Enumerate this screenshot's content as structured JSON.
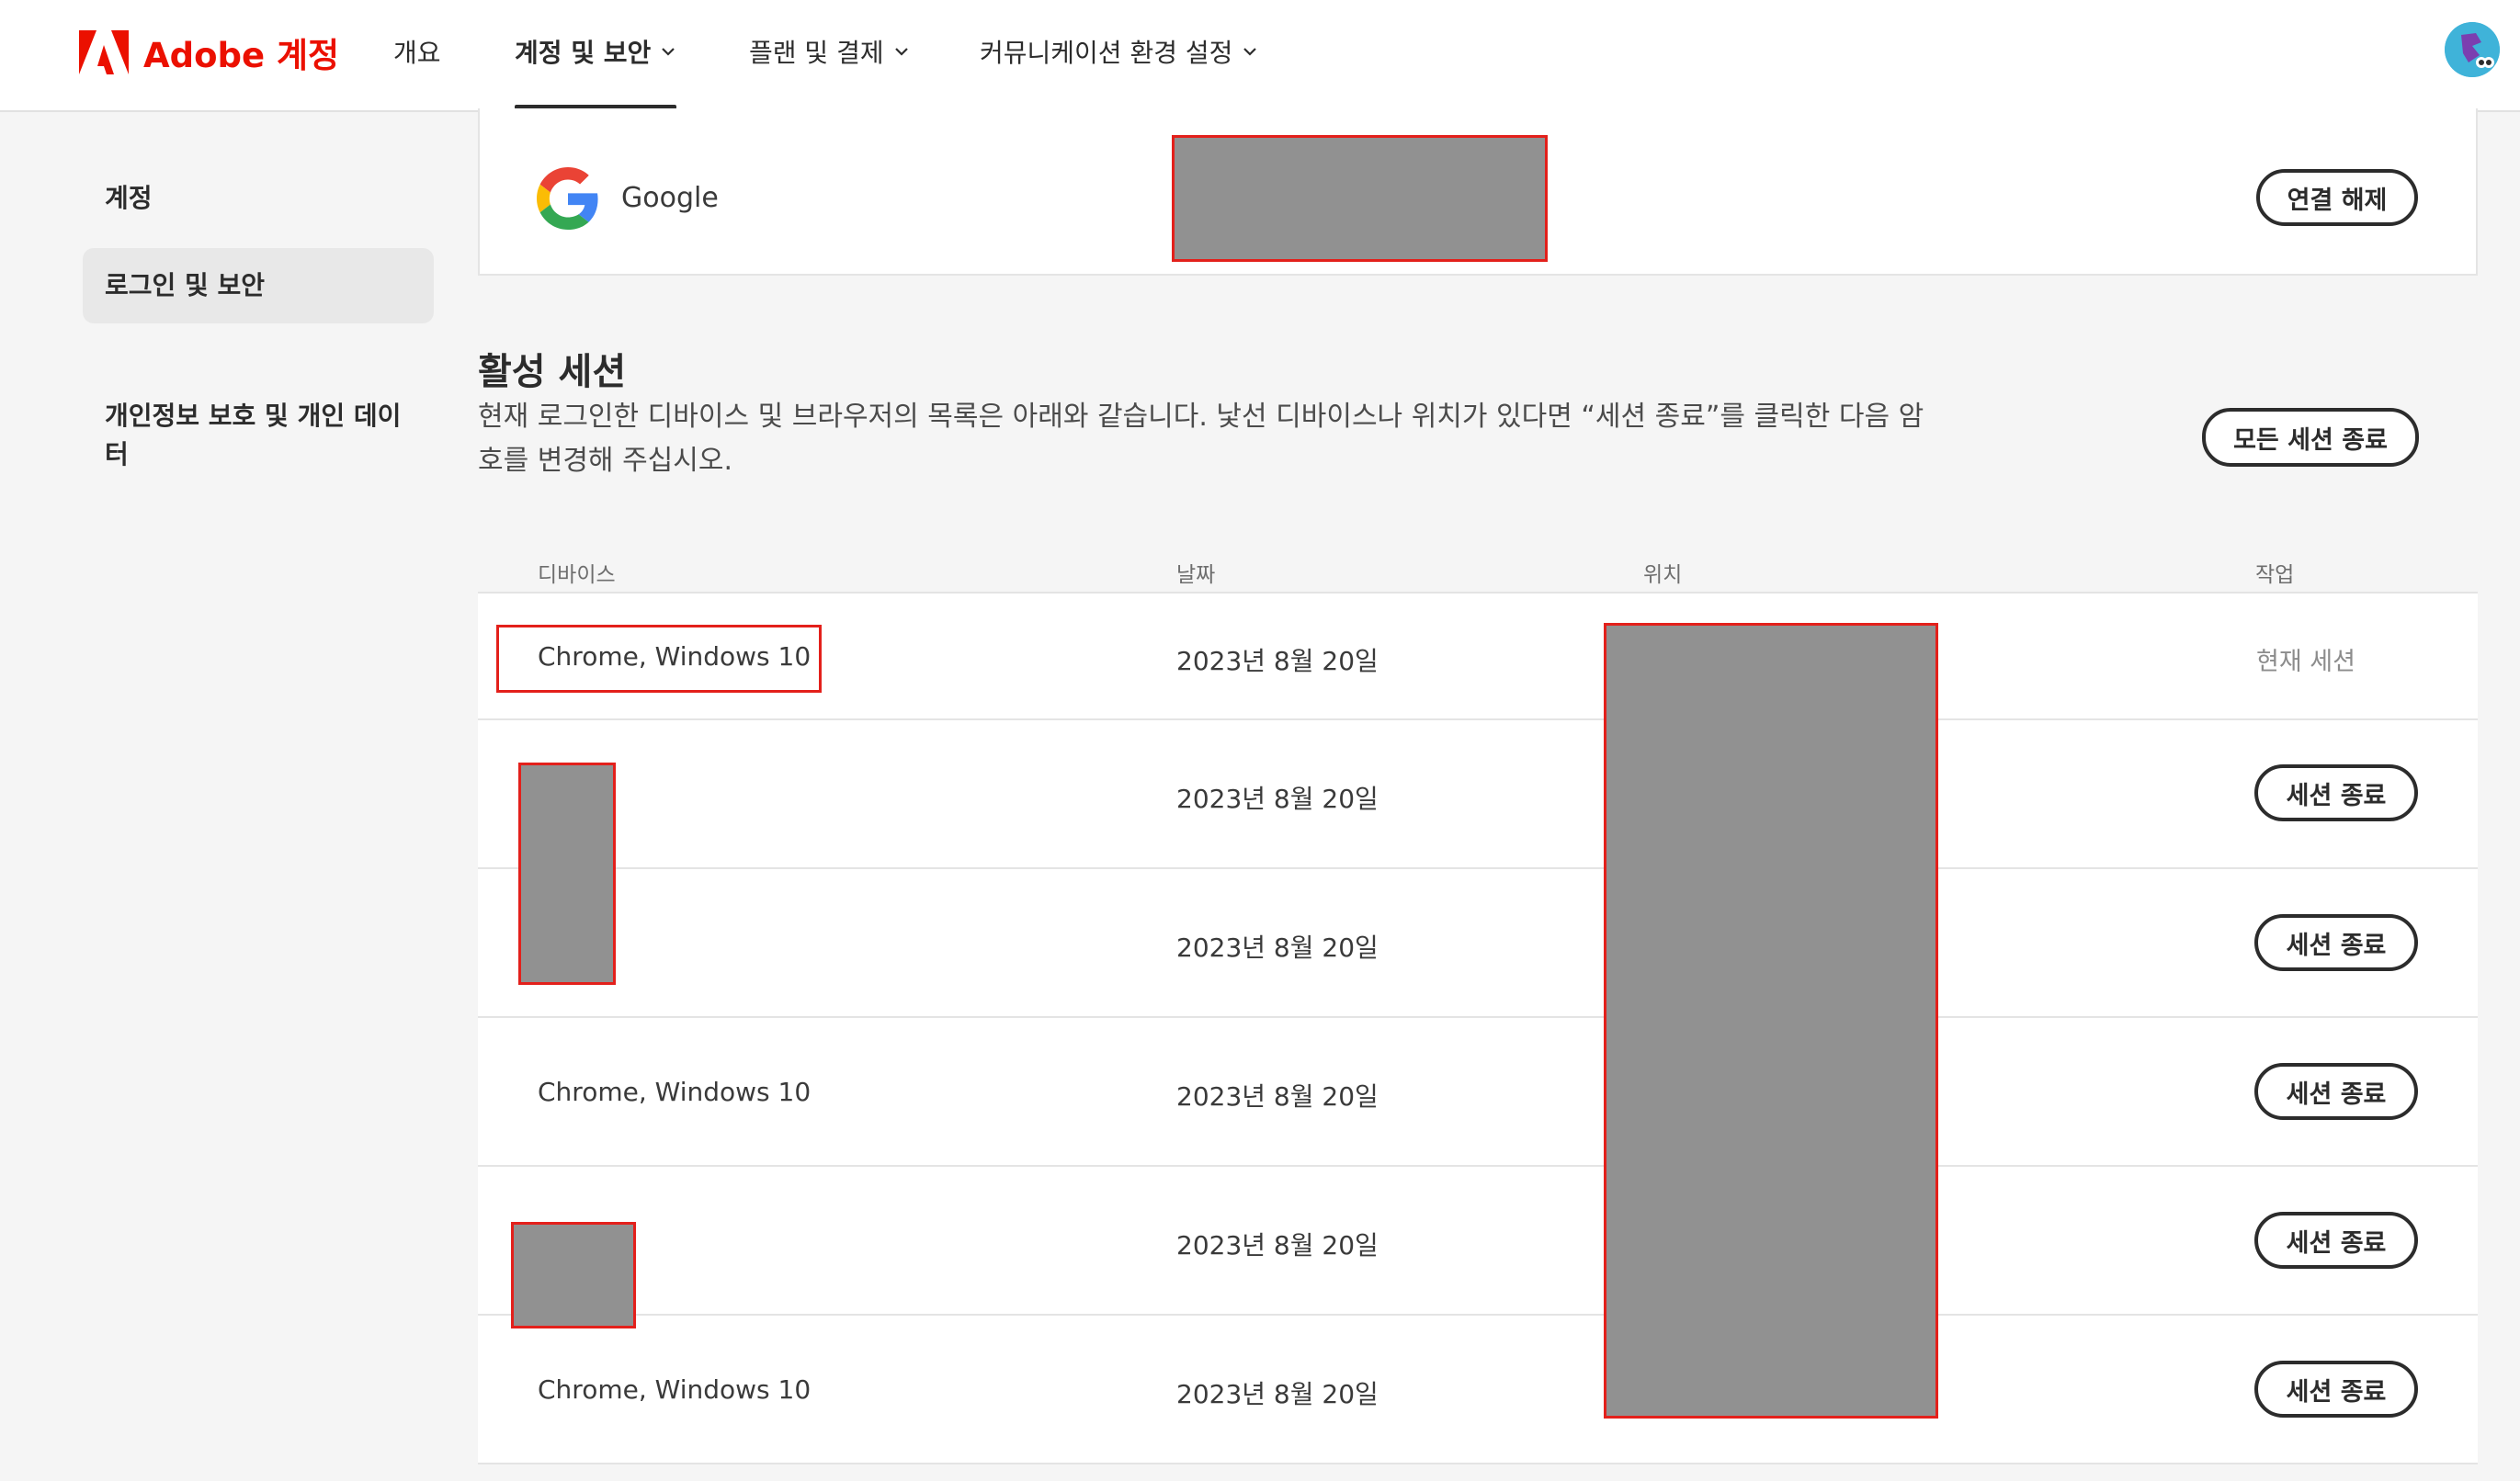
{
  "header": {
    "brand": "Adobe 계정",
    "nav": [
      "개요",
      "계정 및 보안",
      "플랜 및 결제",
      "커뮤니케이션 환경 설정"
    ],
    "active_nav": "계정 및 보안"
  },
  "sidebar": {
    "items": [
      {
        "label": "계정"
      },
      {
        "label": "로그인 및 보안",
        "active": true
      },
      {
        "label": "개인정보 보호 및 개인 데이\n터"
      }
    ]
  },
  "linked_account": {
    "provider": "Google",
    "disconnect_label": "연결 해제"
  },
  "sessions": {
    "title": "활성 세션",
    "description": "현재 로그인한 디바이스 및 브라우저의 목록은 아래와 같습니다. 낯선 디바이스나 위치가 있다면 “세션 종료”를 클릭한 다음 암호를 변경해 주십시오.",
    "end_all_label": "모든 세션 종료",
    "columns": [
      "디바이스",
      "날짜",
      "위치",
      "작업"
    ],
    "rows": [
      {
        "device": "Chrome, Windows 10",
        "date": "2023년 8월 20일",
        "action": "현재 세션"
      },
      {
        "device": "",
        "date": "2023년 8월 20일",
        "action": "세션 종료"
      },
      {
        "device": "",
        "date": "2023년 8월 20일",
        "action": "세션 종료"
      },
      {
        "device": "Chrome, Windows 10",
        "date": "2023년 8월 20일",
        "action": "세션 종료"
      },
      {
        "device": "",
        "date": "2023년 8월 20일",
        "action": "세션 종료"
      },
      {
        "device": "Chrome, Windows 10",
        "date": "2023년 8월 20일",
        "action": "세션 종료"
      }
    ]
  },
  "colors": {
    "brand": "#eb1000",
    "redaction": "#919191",
    "redaction_border": "#e3201b"
  },
  "icons": [
    "adobe-logo-icon",
    "chevron-down-icon",
    "google-g-icon",
    "avatar"
  ]
}
